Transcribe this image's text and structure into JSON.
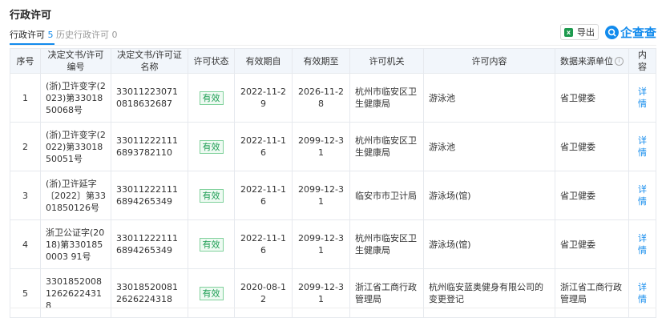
{
  "section": {
    "title": "行政许可",
    "tabs": [
      {
        "label": "行政许可",
        "count": "5"
      },
      {
        "label": "历史行政许可",
        "count": "0"
      }
    ],
    "export_label": "导出",
    "brand_label": "企查查"
  },
  "table": {
    "headers": [
      "序号",
      "决定文书/许可编号",
      "决定文书/许可证名称",
      "许可状态",
      "有效期自",
      "有效期至",
      "许可机关",
      "许可内容",
      "数据来源单位",
      "内容"
    ],
    "rows": [
      {
        "no": "1",
        "doc_no": "(浙)卫许变字(2023)第3301850068号",
        "doc_name": "330112230710818632687",
        "status": "有效",
        "from": "2022-11-29",
        "to": "2026-11-28",
        "authority": "杭州市临安区卫生健康局",
        "content": "游泳池",
        "source": "省卫健委",
        "action": "详情"
      },
      {
        "no": "2",
        "doc_no": "(浙)卫许变字(2022)第3301850051号",
        "doc_name": "330112221116893782110",
        "status": "有效",
        "from": "2022-11-16",
        "to": "2099-12-31",
        "authority": "杭州市临安区卫生健康局",
        "content": "游泳池",
        "source": "省卫健委",
        "action": "详情"
      },
      {
        "no": "3",
        "doc_no": "(浙)卫许延字〔2022〕第3301850126号",
        "doc_name": "330112221116894265349",
        "status": "有效",
        "from": "2022-11-16",
        "to": "2099-12-31",
        "authority": "临安市市卫计局",
        "content": "游泳场(馆)",
        "source": "省卫健委",
        "action": "详情"
      },
      {
        "no": "4",
        "doc_no": "浙卫公证字(2018)第3301850003 91号",
        "doc_name": "330112221116894265349",
        "status": "有效",
        "from": "2022-11-16",
        "to": "2099-12-31",
        "authority": "杭州市临安区卫生健康局",
        "content": "游泳场(馆)",
        "source": "省卫健委",
        "action": "详情"
      },
      {
        "no": "5",
        "doc_no": "330185200812626224318",
        "doc_name": "330185200812626224318",
        "status": "有效",
        "from": "2020-08-12",
        "to": "2099-12-31",
        "authority": "浙江省工商行政管理局",
        "content": "杭州临安蓝奥健身有限公司的变更登记",
        "source": "浙江省工商行政管理局",
        "action": "详情"
      }
    ]
  },
  "colors": {
    "accent": "#128bed",
    "status_green": "#1e9e54",
    "header_bg": "#f2f6fb"
  }
}
